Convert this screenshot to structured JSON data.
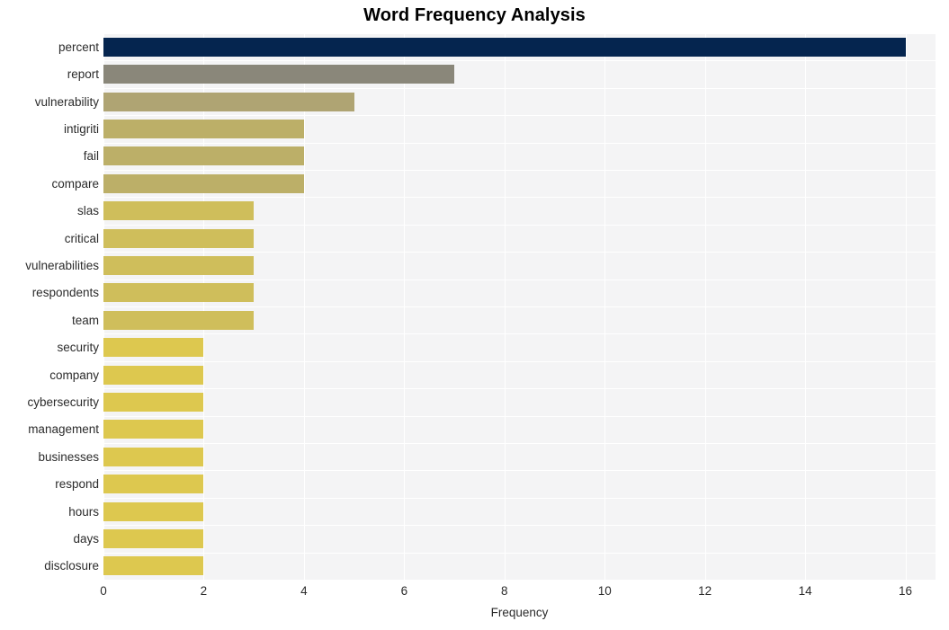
{
  "chart_data": {
    "type": "bar",
    "orientation": "horizontal",
    "title": "Word Frequency Analysis",
    "xlabel": "Frequency",
    "ylabel": "",
    "xlim": [
      0,
      16.6
    ],
    "xticks": [
      0,
      2,
      4,
      6,
      8,
      10,
      12,
      14,
      16
    ],
    "xtick_labels": [
      "0",
      "2",
      "4",
      "6",
      "8",
      "10",
      "12",
      "14",
      "16"
    ],
    "grid": true,
    "legend": null,
    "categories": [
      "percent",
      "report",
      "vulnerability",
      "intigriti",
      "fail",
      "compare",
      "slas",
      "critical",
      "vulnerabilities",
      "respondents",
      "team",
      "security",
      "company",
      "cybersecurity",
      "management",
      "businesses",
      "respond",
      "hours",
      "days",
      "disclosure"
    ],
    "values": [
      16,
      7,
      5,
      4,
      4,
      4,
      3,
      3,
      3,
      3,
      3,
      2,
      2,
      2,
      2,
      2,
      2,
      2,
      2,
      2
    ],
    "bar_colors": [
      "#05254F",
      "#8A877A",
      "#AFA473",
      "#BCAF68",
      "#BCAF68",
      "#BCAF68",
      "#CFBE5B",
      "#CFBE5B",
      "#CFBE5B",
      "#CFBE5B",
      "#CFBE5B",
      "#DDC84F",
      "#DDC84F",
      "#DDC84F",
      "#DDC84F",
      "#DDC84F",
      "#DDC84F",
      "#DDC84F",
      "#DDC84F",
      "#DDC84F"
    ],
    "plot_background": "#F4F4F5",
    "grid_color": "#FFFFFF",
    "figure_background": "#FFFFFF"
  }
}
